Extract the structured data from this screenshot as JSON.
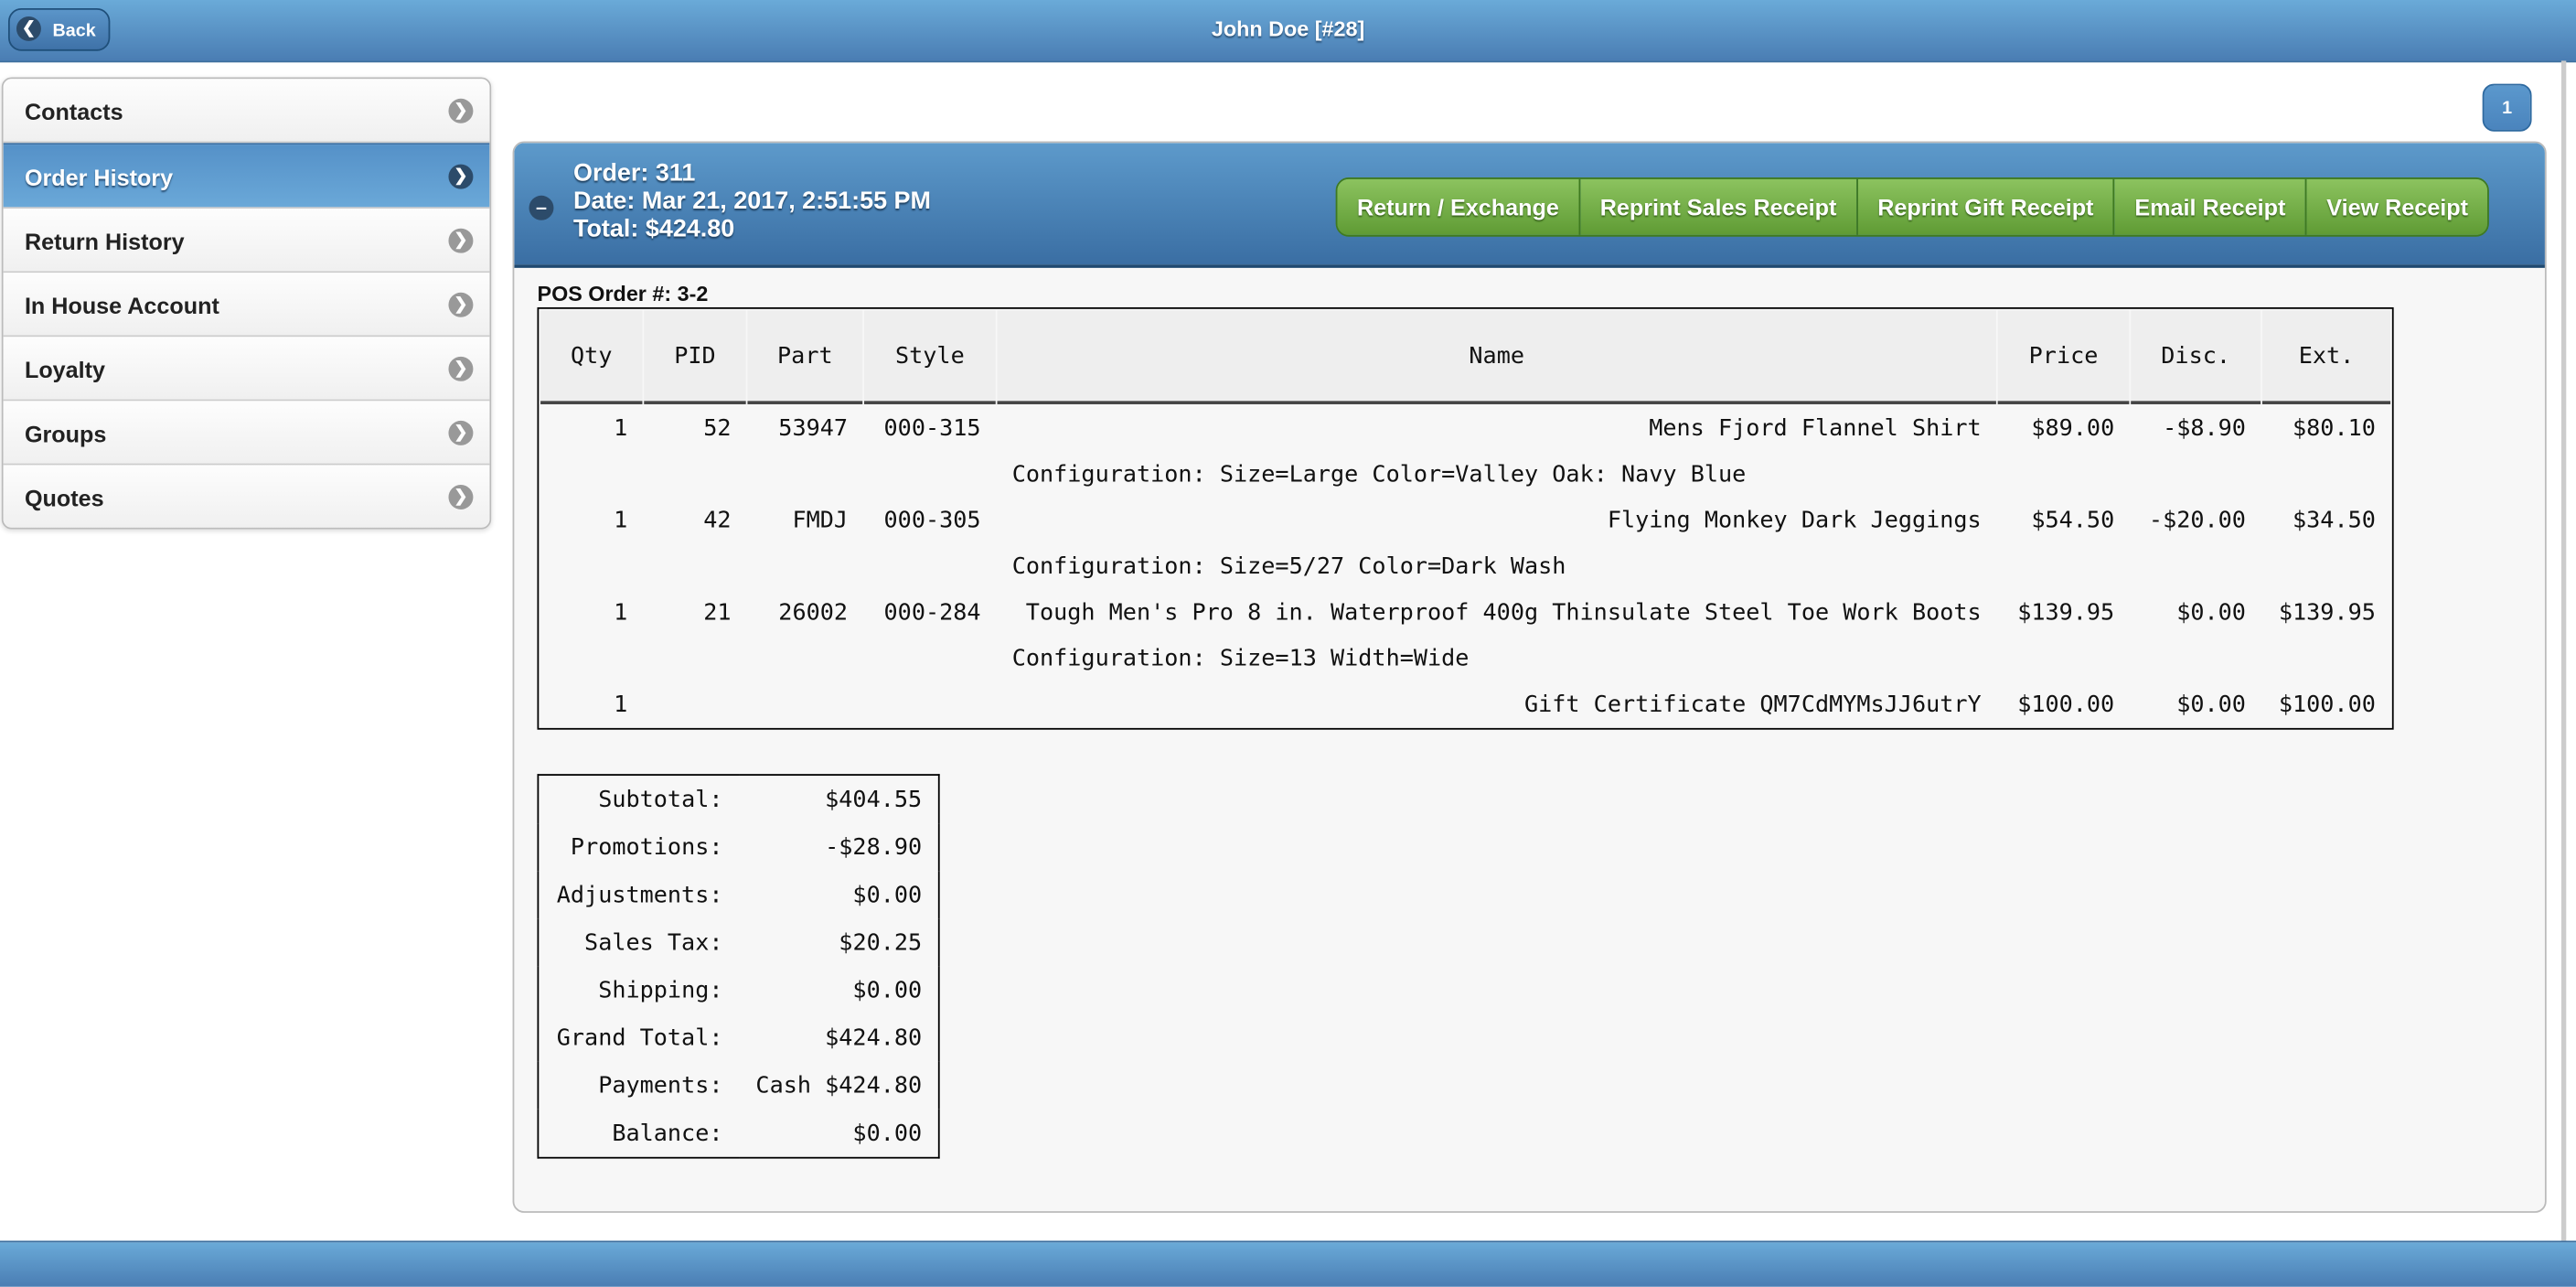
{
  "header": {
    "title": "John Doe [#28]",
    "back_label": "Back"
  },
  "sidebar": {
    "items": [
      {
        "label": "Contacts",
        "selected": false
      },
      {
        "label": "Order History",
        "selected": true
      },
      {
        "label": "Return History",
        "selected": false
      },
      {
        "label": "In House Account",
        "selected": false
      },
      {
        "label": "Loyalty",
        "selected": false
      },
      {
        "label": "Groups",
        "selected": false
      },
      {
        "label": "Quotes",
        "selected": false
      }
    ]
  },
  "pagination": {
    "page": "1"
  },
  "order": {
    "order_line": "Order: 311",
    "date_line": "Date: Mar 21, 2017, 2:51:55 PM",
    "total_line": "Total: $424.80",
    "buttons": [
      "Return / Exchange",
      "Reprint Sales Receipt",
      "Reprint Gift Receipt",
      "Email Receipt",
      "View Receipt"
    ],
    "pos_order": "POS Order #: 3-2",
    "columns": [
      "Qty",
      "PID",
      "Part",
      "Style",
      "Name",
      "Price",
      "Disc.",
      "Ext."
    ],
    "rows": [
      {
        "qty": "1",
        "pid": "52",
        "part": "53947",
        "style": "000-315",
        "name": "Mens Fjord Flannel Shirt",
        "price": "$89.00",
        "disc": "-$8.90",
        "ext": "$80.10",
        "config": "Configuration: Size=Large Color=Valley Oak: Navy Blue"
      },
      {
        "qty": "1",
        "pid": "42",
        "part": "FMDJ",
        "style": "000-305",
        "name": "Flying Monkey Dark Jeggings",
        "price": "$54.50",
        "disc": "-$20.00",
        "ext": "$34.50",
        "config": "Configuration: Size=5/27 Color=Dark Wash"
      },
      {
        "qty": "1",
        "pid": "21",
        "part": "26002",
        "style": "000-284",
        "name": "Tough Men's Pro 8 in. Waterproof 400g Thinsulate Steel Toe Work Boots",
        "price": "$139.95",
        "disc": "$0.00",
        "ext": "$139.95",
        "config": "Configuration: Size=13 Width=Wide"
      },
      {
        "qty": "1",
        "pid": "",
        "part": "",
        "style": "",
        "name": "Gift Certificate QM7CdMYMsJJ6utrY",
        "price": "$100.00",
        "disc": "$0.00",
        "ext": "$100.00",
        "config": ""
      }
    ],
    "totals": [
      {
        "label": "Subtotal:",
        "value": "$404.55"
      },
      {
        "label": "Promotions:",
        "value": "-$28.90"
      },
      {
        "label": "Adjustments:",
        "value": "$0.00"
      },
      {
        "label": "Sales Tax:",
        "value": "$20.25"
      },
      {
        "label": "Shipping:",
        "value": "$0.00"
      },
      {
        "label": "Grand Total:",
        "value": "$424.80"
      },
      {
        "label": "Payments:",
        "value": "Cash $424.80"
      },
      {
        "label": "Balance:",
        "value": "$0.00"
      }
    ]
  },
  "colors": {
    "header": "#4a7db3",
    "selected": "#5591c8",
    "button_green": "#6fa843"
  }
}
